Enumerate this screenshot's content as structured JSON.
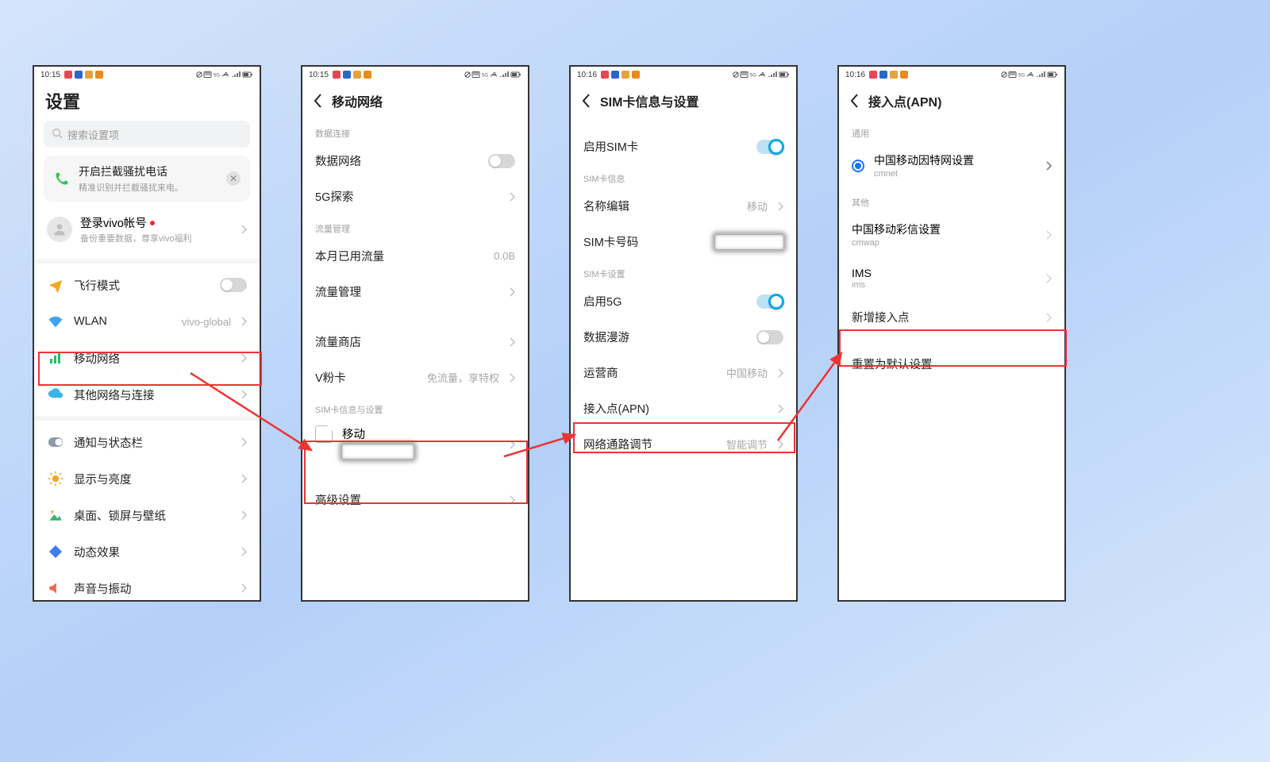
{
  "status": {
    "time1": "10:15",
    "time2": "10:15",
    "time3": "10:16",
    "time4": "10:16"
  },
  "screen1": {
    "title": "设置",
    "search_placeholder": "搜索设置项",
    "banner_title": "开启拦截骚扰电话",
    "banner_sub": "精准识别并拦截骚扰来电。",
    "account_title": "登录vivo帐号",
    "account_sub": "备份重要数据，尊享vivo福利",
    "airplane": "飞行模式",
    "wlan": "WLAN",
    "wlan_value": "vivo-global",
    "mobile_network": "移动网络",
    "other_net": "其他网络与连接",
    "notif": "通知与状态栏",
    "display": "显示与亮度",
    "wallpaper": "桌面、锁屏与壁纸",
    "effects": "动态效果",
    "sound": "声音与振动"
  },
  "screen2": {
    "title": "移动网络",
    "sec1": "数据连接",
    "data_net": "数据网络",
    "five_g": "5G探索",
    "sec2": "流量管理",
    "used": "本月已用流量",
    "used_value": "0.0B",
    "data_mgmt": "流量管理",
    "data_shop": "流量商店",
    "v_card": "V粉卡",
    "v_card_value": "免流量，享特权",
    "sec3": "SIM卡信息与设置",
    "sim_name": "移动",
    "advanced": "高级设置"
  },
  "screen3": {
    "title": "SIM卡信息与设置",
    "enable_sim": "启用SIM卡",
    "sec1": "SIM卡信息",
    "name_edit": "名称编辑",
    "name_edit_value": "移动",
    "sim_number": "SIM卡号码",
    "sec2": "SIM卡设置",
    "enable_5g": "启用5G",
    "roaming": "数据漫游",
    "carrier": "运营商",
    "carrier_value": "中国移动",
    "apn": "接入点(APN)",
    "path_adj": "网络通路调节",
    "path_adj_value": "智能调节"
  },
  "screen4": {
    "title": "接入点(APN)",
    "sec1": "通用",
    "apn1_title": "中国移动因特网设置",
    "apn1_sub": "cmnet",
    "sec2": "其他",
    "apn2_title": "中国移动彩信设置",
    "apn2_sub": "cmwap",
    "apn3_title": "IMS",
    "apn3_sub": "ims",
    "add_apn": "新增接入点",
    "reset": "重置为默认设置"
  }
}
